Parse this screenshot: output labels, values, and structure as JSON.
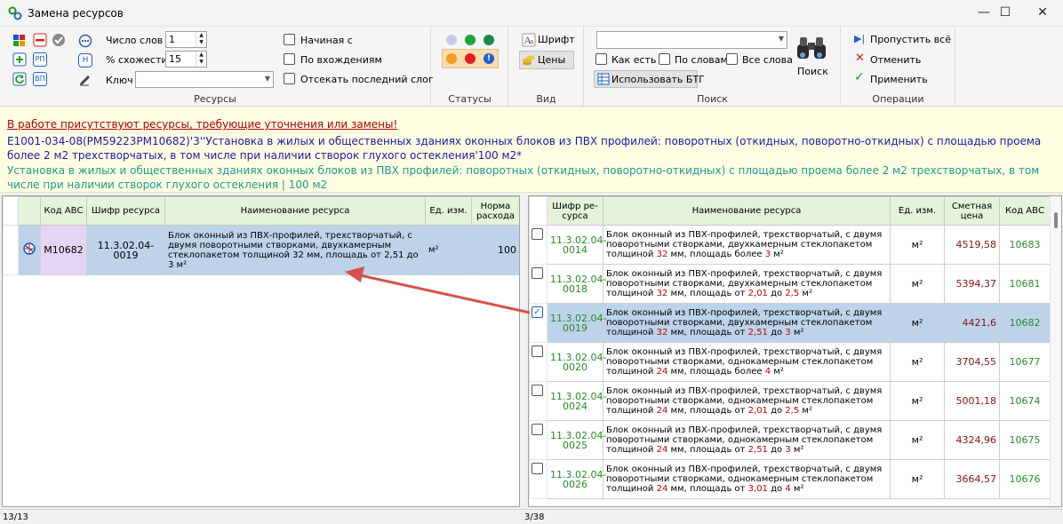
{
  "window": {
    "title": "Замена ресурсов",
    "minimize": "—",
    "maximize": "☐",
    "close": "✕"
  },
  "ribbon": {
    "resources": {
      "label": "Ресурсы",
      "word_count_label": "Число слов",
      "word_count_value": "1",
      "similarity_label": "% схожести",
      "similarity_value": "15",
      "key_label": "Ключ",
      "key_value": "",
      "btn_rp": "РП",
      "btn_vp": "ВП",
      "btn_h": "Н",
      "chk_starts": "Начиная с",
      "chk_occurrences": "По вхождениям",
      "chk_cut_syllable": "Отсекать последний слог"
    },
    "statuses": {
      "label": "Статусы"
    },
    "view": {
      "label": "Вид",
      "font_btn": "Шрифт",
      "prices_btn": "Цены"
    },
    "search": {
      "label": "Поиск",
      "combo_value": "",
      "chk_as_is": "Как есть",
      "chk_by_words": "По словам",
      "chk_all_words": "Все слова",
      "use_btg": "Использовать БТГ",
      "search_btn": "Поиск"
    },
    "operations": {
      "label": "Операции",
      "skip_all": "Пропустить всё",
      "cancel": "Отменить",
      "apply": "Применить"
    }
  },
  "warning": {
    "line1": "В работе присутствуют ресурсы, требующие уточнения или замены!",
    "line2": "Е1001-034-08(РМ59223РМ10682)'3''Установка в жилых и общественных зданиях оконных блоков из ПВХ профилей: поворотных (откидных, поворотно-откидных) с площадью проема более 2 м2 трехстворчатых, в том числе при наличии створок глухого остекления'100 м2*",
    "line3": "Установка в жилых и общественных зданиях оконных блоков из ПВХ профилей: поворотных (откидных, поворотно-откидных) с площадью проема более 2 м2 трехстворчатых, в том числе при наличии створок глухого остекления   |   100 м2"
  },
  "left_table": {
    "headers": [
      "Код АВС",
      "Шифр ресурса",
      "Наименование ресурса",
      "Ед. изм.",
      "Норма расхода"
    ],
    "row": {
      "kod": "М10682",
      "shifr": "11.3.02.04-0019",
      "name": "Блок оконный из ПВХ-профилей, трехстворчатый, с двумя поворотными створками, двухкамерным стеклопакетом толщиной 32 мм, площадь от 2,51 до 3 м²",
      "ed": "м²",
      "norma": "100"
    }
  },
  "right_table": {
    "headers": [
      "Шифр ре-сурса",
      "Наименование ресурса",
      "Ед. изм.",
      "Сметная цена",
      "Код АВС"
    ],
    "rows": [
      {
        "checked": false,
        "shifr": "11.3.02.04-0014",
        "n1": "Блок оконный из ПВХ-профилей, трехстворчатый, с двумя",
        "n2": "поворотными створками, двухкамерным стеклопакетом",
        "n3a": "толщиной ",
        "v1": "32",
        "n3b": " мм, площадь более ",
        "v2": "3",
        "n3c": " м²",
        "n3d": "",
        "v3": "",
        "n3e": "",
        "ed": "м²",
        "price": "4519,58",
        "kod": "10683",
        "selected": false
      },
      {
        "checked": false,
        "shifr": "11.3.02.04-0018",
        "n1": "Блок оконный из ПВХ-профилей, трехстворчатый, с двумя",
        "n2": "поворотными створками, двухкамерным стеклопакетом",
        "n3a": "толщиной ",
        "v1": "32",
        "n3b": " мм, площадь от ",
        "v2": "2,01",
        "n3c": " до ",
        "n3d": "",
        "v3": "2,5",
        "n3e": " м²",
        "ed": "м²",
        "price": "5394,37",
        "kod": "10681",
        "selected": false
      },
      {
        "checked": true,
        "shifr": "11.3.02.04-0019",
        "n1": "Блок оконный из ПВХ-профилей, трехстворчатый, с двумя",
        "n2": "поворотными створками, двухкамерным стеклопакетом",
        "n3a": "толщиной ",
        "v1": "32",
        "n3b": " мм, площадь от ",
        "v2": "2,51",
        "n3c": " до ",
        "n3d": "",
        "v3": "3",
        "n3e": " м²",
        "ed": "м²",
        "price": "4421,6",
        "kod": "10682",
        "selected": true
      },
      {
        "checked": false,
        "shifr": "11.3.02.04-0020",
        "n1": "Блок оконный из ПВХ-профилей, трехстворчатый, с двумя",
        "n2": "поворотными створками, однокамерным стеклопакетом",
        "n3a": "толщиной ",
        "v1": "24",
        "n3b": " мм, площадь более ",
        "v2": "4",
        "n3c": " м²",
        "n3d": "",
        "v3": "",
        "n3e": "",
        "ed": "м²",
        "price": "3704,55",
        "kod": "10677",
        "selected": false
      },
      {
        "checked": false,
        "shifr": "11.3.02.04-0024",
        "n1": "Блок оконный из ПВХ-профилей, трехстворчатый, с двумя",
        "n2": "поворотными створками, однокамерным стеклопакетом",
        "n3a": "толщиной ",
        "v1": "24",
        "n3b": " мм, площадь от ",
        "v2": "2,01",
        "n3c": " до ",
        "n3d": "",
        "v3": "2,5",
        "n3e": " м²",
        "ed": "м²",
        "price": "5001,18",
        "kod": "10674",
        "selected": false
      },
      {
        "checked": false,
        "shifr": "11.3.02.04-0025",
        "n1": "Блок оконный из ПВХ-профилей, трехстворчатый, с двумя",
        "n2": "поворотными створками, однокамерным стеклопакетом",
        "n3a": "толщиной ",
        "v1": "24",
        "n3b": " мм, площадь от ",
        "v2": "2,51",
        "n3c": " до ",
        "n3d": "",
        "v3": "3",
        "n3e": " м²",
        "ed": "м²",
        "price": "4324,96",
        "kod": "10675",
        "selected": false
      },
      {
        "checked": false,
        "shifr": "11.3.02.04-0026",
        "n1": "Блок оконный из ПВХ-профилей, трехстворчатый, с двумя",
        "n2": "поворотными створками, однокамерным стеклопакетом",
        "n3a": "толщиной ",
        "v1": "24",
        "n3b": " мм, площадь от ",
        "v2": "3,01",
        "n3c": " до ",
        "n3d": "",
        "v3": "4",
        "n3e": " м²",
        "ed": "м²",
        "price": "3664,57",
        "kod": "10676",
        "selected": false
      }
    ]
  },
  "statusbar": {
    "left": "13/13",
    "right": "3/38"
  },
  "colors": {
    "header_bg": "#e4f3d9",
    "selected_row": "#bcd3ea",
    "arrow": "#d4524a",
    "warning_red": "#b00000",
    "cipher_blue": "#1a1aa8",
    "text_teal": "#1e9a90"
  }
}
